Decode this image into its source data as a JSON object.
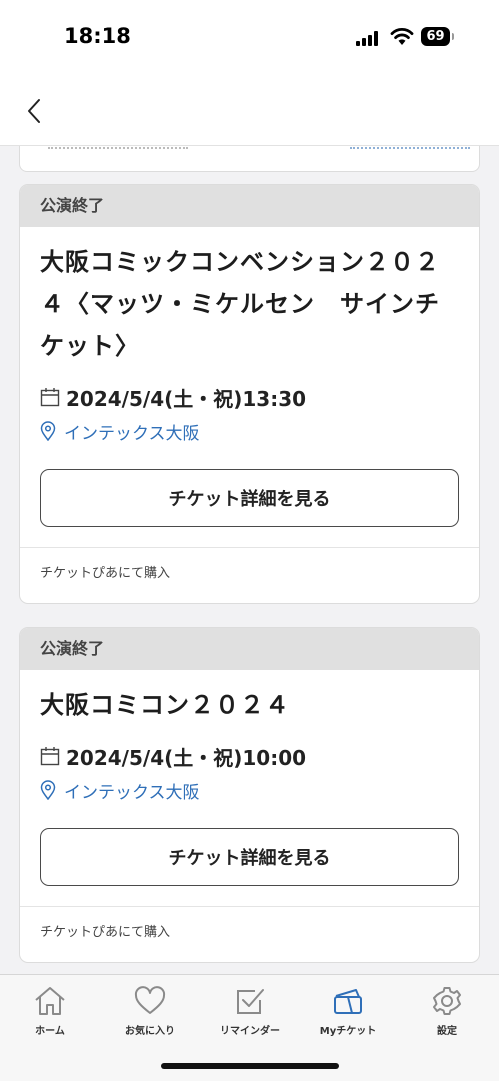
{
  "status_bar": {
    "time": "18:18",
    "battery": "69"
  },
  "cards": [
    {
      "status": "公演終了",
      "title": "大阪コミックコンベンション２０２４〈マッツ・ミケルセン　サインチケット〉",
      "date": "2024/5/4(土・祝)13:30",
      "venue": "インテックス大阪",
      "button": "チケット詳細を見る",
      "footer": "チケットぴあにて購入"
    },
    {
      "status": "公演終了",
      "title": "大阪コミコン２０２４",
      "date": "2024/5/4(土・祝)10:00",
      "venue": "インテックス大阪",
      "button": "チケット詳細を見る",
      "footer": "チケットぴあにて購入"
    }
  ],
  "tabbar": {
    "items": [
      {
        "label": "ホーム",
        "icon": "home-icon"
      },
      {
        "label": "お気に入り",
        "icon": "heart-icon"
      },
      {
        "label": "リマインダー",
        "icon": "checkbox-icon"
      },
      {
        "label": "Myチケット",
        "icon": "ticket-icon",
        "active": true
      },
      {
        "label": "設定",
        "icon": "gear-icon"
      }
    ]
  },
  "colors": {
    "accent": "#2f6fb8",
    "status_bg": "#e0e0e0"
  }
}
